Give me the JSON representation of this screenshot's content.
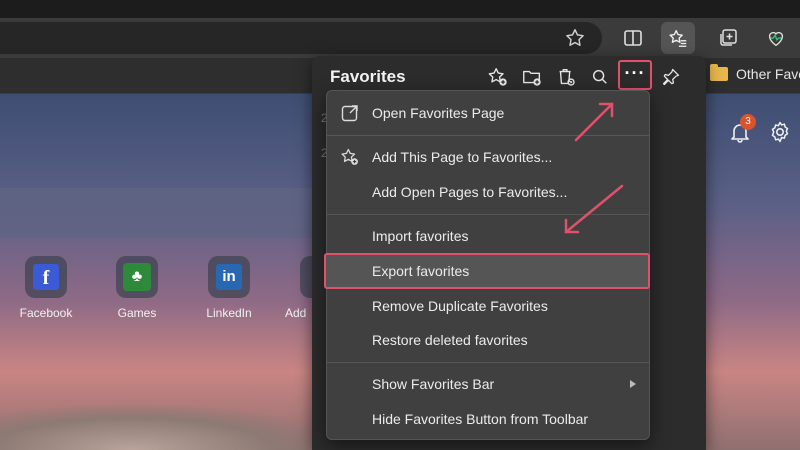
{
  "browser": {
    "favorites_bar": {
      "other_favorites_label": "Other Favo"
    },
    "notifications": {
      "badge_count": "3"
    }
  },
  "new_tab": {
    "tiles": [
      {
        "label": "Facebook",
        "glyph": "f"
      },
      {
        "label": "Games",
        "glyph": "♣"
      },
      {
        "label": "LinkedIn",
        "glyph": "in"
      },
      {
        "label": "Add",
        "glyph": ""
      }
    ]
  },
  "favorites_panel": {
    "title": "Favorites",
    "more_options_label": "···",
    "ghost_left_chars": [
      "2",
      "2"
    ],
    "menu": {
      "items": [
        {
          "label": "Open Favorites Page",
          "icon": "external-link-icon"
        },
        {
          "label": "Add This Page to Favorites...",
          "icon": "star-plus-icon"
        },
        {
          "label": "Add Open Pages to Favorites...",
          "icon": ""
        },
        {
          "label": "Import favorites",
          "icon": ""
        },
        {
          "label": "Export favorites",
          "icon": "",
          "highlighted": true
        },
        {
          "label": "Remove Duplicate Favorites",
          "icon": ""
        },
        {
          "label": "Restore deleted favorites",
          "icon": ""
        },
        {
          "label": "Show Favorites Bar",
          "icon": "",
          "submenu": true
        },
        {
          "label": "Hide Favorites Button from Toolbar",
          "icon": ""
        }
      ]
    }
  },
  "colors": {
    "highlight_outline": "#e0516b",
    "menu_bg": "#404040",
    "panel_bg": "#2c2c2c"
  }
}
